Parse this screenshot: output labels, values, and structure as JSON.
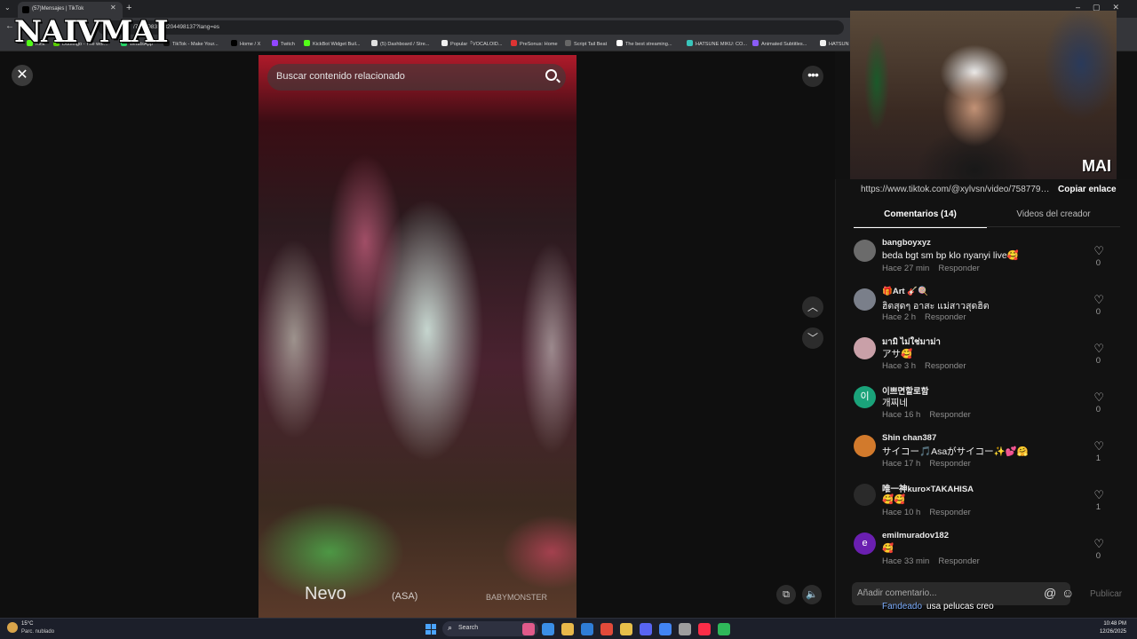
{
  "browser": {
    "active_tab_title": "(57)Mensajes | TikTok",
    "url": "/7587983203204498137?lang=es",
    "bookmarks": [
      {
        "label": "Kick",
        "color": "#53fc18"
      },
      {
        "label": "Duolingo - The wor...",
        "color": "#58cc02"
      },
      {
        "label": "WhatsApp",
        "color": "#25d366"
      },
      {
        "label": "TikTok - Make Your...",
        "color": "#111111"
      },
      {
        "label": "Home / X",
        "color": "#000000"
      },
      {
        "label": "Twitch",
        "color": "#9146ff"
      },
      {
        "label": "KickBot Widget Buil...",
        "color": "#53fc18"
      },
      {
        "label": "(5) Dashboard / Stre...",
        "color": "#e0e0e0"
      },
      {
        "label": "Popular「VOCALOID...",
        "color": "#f0f0f0"
      },
      {
        "label": "PreSonus: Home",
        "color": "#d33"
      },
      {
        "label": "Script Tail Beat",
        "color": "#666"
      },
      {
        "label": "The best streaming...",
        "color": "#ffffff"
      },
      {
        "label": "HATSUNE MIKU: CO...",
        "color": "#39c5bb"
      },
      {
        "label": "Animated Subtitles...",
        "color": "#8a5cf6"
      },
      {
        "label": "HATSUN",
        "color": "#f0f0f0"
      }
    ]
  },
  "overlay_logo": "NAIVMAI",
  "viewer": {
    "search_placeholder": "Buscar contenido relacionado",
    "watermark_nevo": "Nevo",
    "watermark_asa": "(ASA)",
    "watermark_group": "BABYMONSTER"
  },
  "webcam_tag": "MAI",
  "panel": {
    "link": "https://www.tiktok.com/@xylvsn/video/758779832...",
    "copy_label": "Copiar enlace",
    "tab_comments": "Comentarios (14)",
    "tab_videos": "Videos del creador",
    "reply_label": "Responder",
    "comments": [
      {
        "user": "bangboyxyz",
        "text": "beda bgt sm bp klo nyanyi live🥰",
        "time": "Hace 27 min",
        "likes": "0",
        "avatar": "",
        "avatar_color": "#6b6b6b"
      },
      {
        "user": "🎁Art 🎸🍭",
        "text": "ฮิตสุดๆ อาสะ แม่สาวสุดฮิต",
        "time": "Hace 2 h",
        "likes": "0",
        "avatar": "",
        "avatar_color": "#7a7f8a"
      },
      {
        "user": "มามิ ไม่ใช่มาม่า",
        "text": "アサ🥰",
        "time": "Hace 3 h",
        "likes": "0",
        "avatar": "",
        "avatar_color": "#c9a0a8"
      },
      {
        "user": "이쁘면할로함",
        "text": "개찌네",
        "time": "Hace 16 h",
        "likes": "0",
        "avatar": "이",
        "avatar_color": "#1aa37a"
      },
      {
        "user": "Shin chan387",
        "text": "サイコー🎵Asaがサイコー✨💕🤗",
        "time": "Hace 17 h",
        "likes": "1",
        "avatar": "",
        "avatar_color": "#d27a2c"
      },
      {
        "user": "唯一神kuro×TAKAHISA",
        "text": "🥰🥰",
        "time": "Hace 10 h",
        "likes": "1",
        "avatar": "",
        "avatar_color": "#2a2a2a"
      },
      {
        "user": "emilmuradov182",
        "text": "🥰",
        "time": "Hace 33 min",
        "likes": "0",
        "avatar": "e",
        "avatar_color": "#6a1fb0"
      }
    ],
    "input_placeholder": "Añadir comentario...",
    "publish_label": "Publicar",
    "chat_user": "Fandeado",
    "chat_text": "usa pelucas creo"
  },
  "taskbar": {
    "weather_temp": "15°C",
    "weather_desc": "Parc. nublado",
    "search_label": "Search",
    "time": "10:48 PM",
    "date": "12/26/2025",
    "app_colors": [
      "#e05a8a",
      "#3a8ee6",
      "#e8b84a",
      "#2f7dd6",
      "#e24a3a",
      "#e8c04a",
      "#5865f2",
      "#4285f4",
      "#9e9e9e",
      "#fa2d48",
      "#2fb85a"
    ]
  }
}
